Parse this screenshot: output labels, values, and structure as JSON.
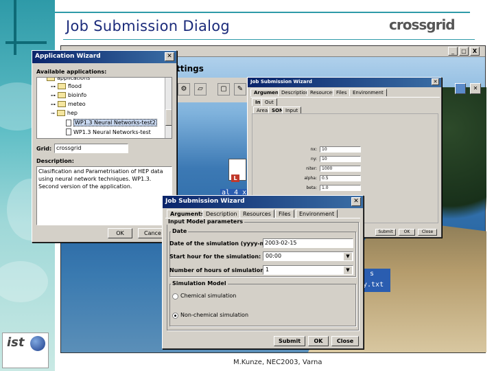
{
  "slide": {
    "title": "Job Submission Dialog",
    "logo_text": "crossgrid",
    "footer": "M.Kunze, NEC2003, Varna",
    "ist_logo": "ist"
  },
  "main_window": {
    "title_partial": "ttings",
    "window_buttons": [
      "_",
      "□",
      "X"
    ]
  },
  "desktop": {
    "text_fragment_1": "al 4 x",
    "text_fragment_2": "s",
    "text_fragment_3": "y.txt"
  },
  "app_wizard": {
    "title": "Application Wizard",
    "available_label": "Available applications:",
    "tree": [
      {
        "label": "applications",
        "type": "folder"
      },
      {
        "label": "flood",
        "type": "folder"
      },
      {
        "label": "bioinfo",
        "type": "folder"
      },
      {
        "label": "meteo",
        "type": "folder"
      },
      {
        "label": "hep",
        "type": "folder"
      },
      {
        "label": "WP1.3 Neural Networks-test2",
        "type": "doc",
        "selected": true
      },
      {
        "label": "WP1.3 Neural Networks-test",
        "type": "doc"
      }
    ],
    "grid_label": "Grid:",
    "grid_value": "crossgrid",
    "description_label": "Description:",
    "description": "Clasification and Parametrisation of HEP data using neural network techniques. WP1.3. Second version of the application.",
    "ok_label": "OK",
    "cancel_label": "Cance"
  },
  "jsw_back": {
    "title": "Job Submission Wizard",
    "tabs": [
      "Arguments",
      "Description",
      "Resources",
      "Files",
      "Environment"
    ],
    "subtabs": [
      "In",
      "Out"
    ],
    "subtabs2": [
      "Area",
      "SOM",
      "Input"
    ],
    "params": [
      {
        "label": "nx:",
        "value": "10"
      },
      {
        "label": "ny:",
        "value": "10"
      },
      {
        "label": "niter:",
        "value": "1000"
      },
      {
        "label": "alpha:",
        "value": "0.5"
      },
      {
        "label": "beta:",
        "value": "1.0"
      }
    ],
    "submit_label": "Submit",
    "ok_label": "OK",
    "close_label": "Close"
  },
  "jsw_front": {
    "title": "Job Submission Wizard",
    "tabs": [
      "Arguments",
      "Description",
      "Resources",
      "Files",
      "Environment"
    ],
    "input_group": "Input Model parameters",
    "date_group": "Date",
    "date_label": "Date of the simulation (yyyy-mm-dd)",
    "date_value": "2003-02-15",
    "start_label": "Start hour for the simulation:",
    "start_value": "00:00",
    "hours_label": "Number of hours of simulation:",
    "hours_value": "1",
    "model_group": "Simulation Model",
    "radio_chem": "Chemical simulation",
    "radio_nonchem": "Non-chemical simulation",
    "submit_label": "Submit",
    "ok_label": "OK",
    "close_label": "Close"
  }
}
